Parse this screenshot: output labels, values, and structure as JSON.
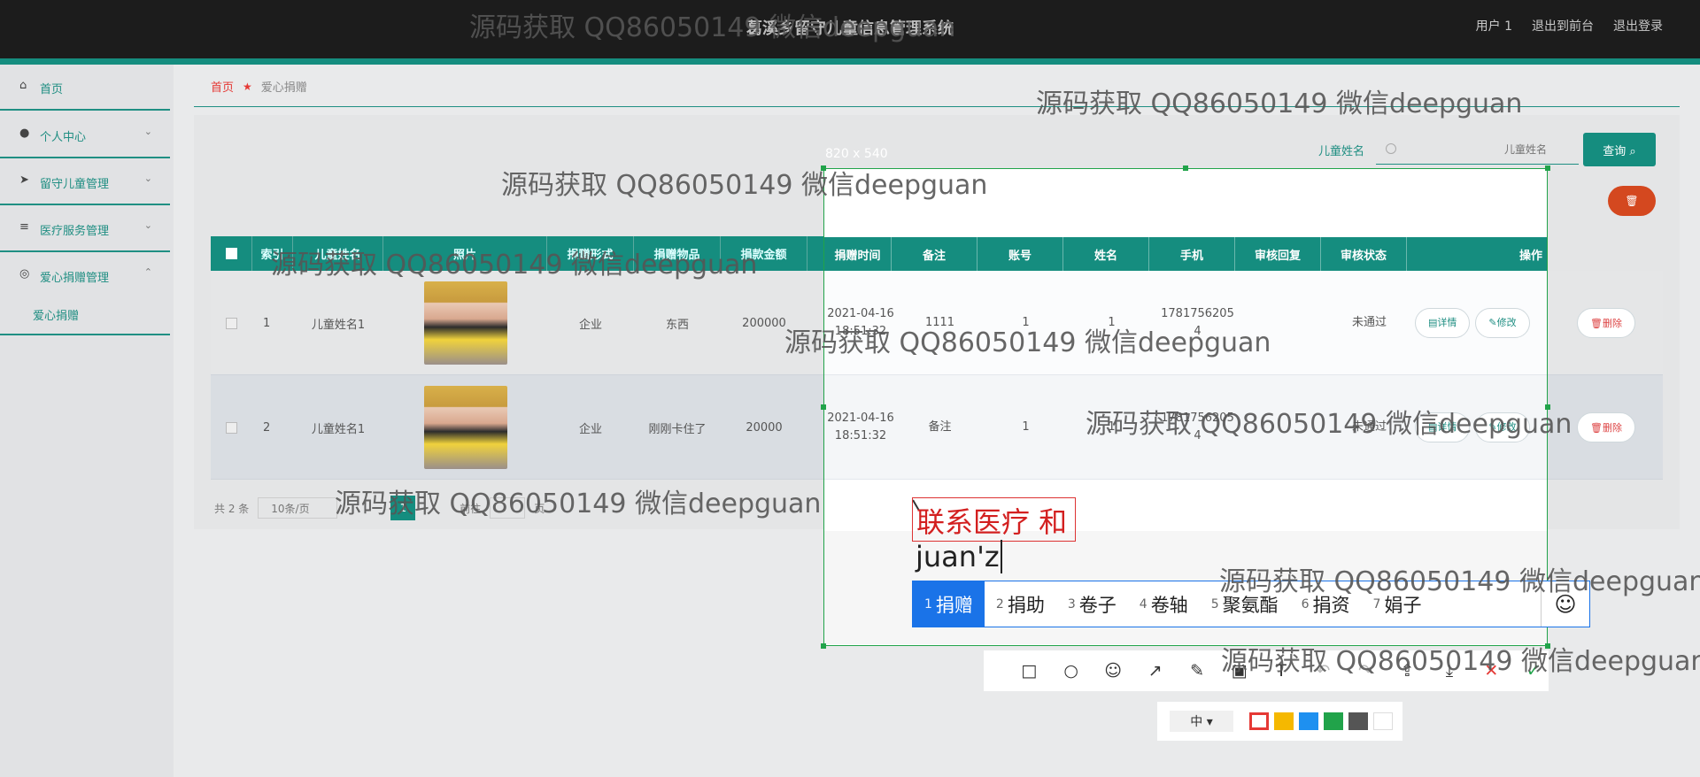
{
  "header": {
    "title": "葛溪乡留守儿童信息管理系统",
    "user": "用户 1",
    "to_front": "退出到前台",
    "logout": "退出登录"
  },
  "sidebar": {
    "items": [
      {
        "label": "首页",
        "icon": "home-icon"
      },
      {
        "label": "个人中心",
        "icon": "user-icon"
      },
      {
        "label": "留守儿童管理",
        "icon": "send-icon"
      },
      {
        "label": "医疗服务管理",
        "icon": "list-icon"
      },
      {
        "label": "爱心捐赠管理",
        "icon": "globe-icon"
      }
    ],
    "sub_item": "爱心捐赠"
  },
  "breadcrumb": {
    "home": "首页",
    "current": "爱心捐赠"
  },
  "search": {
    "label": "儿童姓名",
    "placeholder": "儿童姓名",
    "button": "查询"
  },
  "table": {
    "columns": [
      "索引",
      "儿童姓名",
      "照片",
      "捐赠形式",
      "捐赠物品",
      "捐款金额"
    ],
    "rows": [
      {
        "index": "1",
        "child": "儿童姓名1",
        "form": "企业",
        "goods": "东西",
        "amount": "200000"
      },
      {
        "index": "2",
        "child": "儿童姓名1",
        "form": "企业",
        "goods": "刚刚卡住了",
        "amount": "20000"
      }
    ]
  },
  "pagination": {
    "total": "共 2 条",
    "page_size": "10条/页",
    "page": "1",
    "goto": "前往",
    "page_unit": "页"
  },
  "capture": {
    "size_label": "820 x 540",
    "columns": [
      "捐赠时间",
      "备注",
      "账号",
      "姓名",
      "手机",
      "审核回复",
      "审核状态",
      "操作"
    ],
    "rows": [
      {
        "time": "2021-04-16",
        "time2": "18:51:32",
        "note": "1111",
        "account": "1",
        "name": "1",
        "phone": "1781756205",
        "phone2": "4",
        "reply": "",
        "status": "未通过"
      },
      {
        "time": "2021-04-16",
        "time2": "18:51:32",
        "note": "备注",
        "account": "1",
        "name": "1",
        "phone": "1781756205",
        "phone2": "4",
        "reply": "",
        "status": "未通过"
      }
    ],
    "actions": {
      "detail": "详情",
      "edit": "修改",
      "delete": "删除"
    }
  },
  "ime": {
    "composition": "联系医疗 和",
    "typed": "juan'z",
    "candidates": [
      {
        "n": "1",
        "t": "捐赠"
      },
      {
        "n": "2",
        "t": "捐助"
      },
      {
        "n": "3",
        "t": "卷子"
      },
      {
        "n": "4",
        "t": "卷轴"
      },
      {
        "n": "5",
        "t": "聚氨酯"
      },
      {
        "n": "6",
        "t": "捐资"
      },
      {
        "n": "7",
        "t": "娟子"
      }
    ],
    "emoji": "☺"
  },
  "toolbar": {
    "size_label": "中 ▾"
  },
  "palette_colors": [
    "#e53935",
    "#f5b800",
    "#1e90f0",
    "#21a34a",
    "#555555",
    "#ffffff"
  ],
  "watermark": "源码获取 QQ86050149 微信deepguan"
}
